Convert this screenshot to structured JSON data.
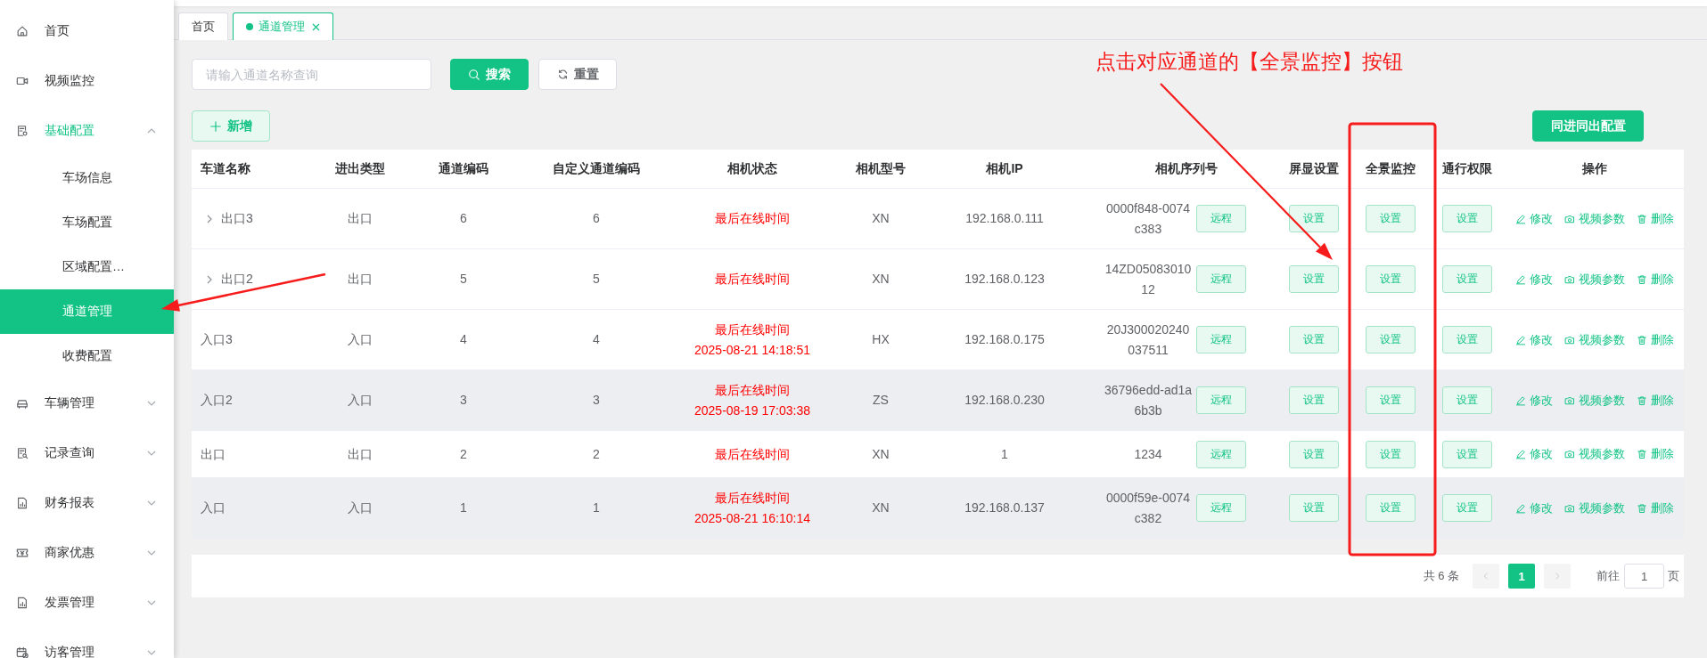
{
  "sidebar": {
    "items": [
      {
        "label": "首页",
        "selected": false
      },
      {
        "label": "视频监控",
        "selected": false
      },
      {
        "label": "基础配置",
        "selected": true,
        "expanded": true,
        "children": [
          {
            "label": "车场信息",
            "selected": false
          },
          {
            "label": "车场配置",
            "selected": false
          },
          {
            "label": "区域配置…",
            "selected": false
          },
          {
            "label": "通道管理",
            "selected": true
          },
          {
            "label": "收费配置",
            "selected": false
          }
        ]
      },
      {
        "label": "车辆管理",
        "selected": false,
        "expanded": false
      },
      {
        "label": "记录查询",
        "selected": false,
        "expanded": false
      },
      {
        "label": "财务报表",
        "selected": false,
        "expanded": false
      },
      {
        "label": "商家优惠",
        "selected": false,
        "expanded": false
      },
      {
        "label": "发票管理",
        "selected": false,
        "expanded": false
      },
      {
        "label": "访客管理",
        "selected": false,
        "expanded": false
      }
    ]
  },
  "tabs": [
    {
      "label": "首页",
      "selected": false,
      "closable": false
    },
    {
      "label": "通道管理",
      "selected": true,
      "closable": true
    }
  ],
  "toolbar": {
    "search": {
      "placeholder": "请输入通道名称查询"
    },
    "search_button": "搜索",
    "reset_button": "重置",
    "add_button": "新增",
    "sync_button": "同进同出配置"
  },
  "annotation": {
    "text": "点击对应通道的【全景监控】按钮"
  },
  "table": {
    "columns": [
      "车道名称",
      "进出类型",
      "通道编码",
      "自定义通道编码",
      "相机状态",
      "相机型号",
      "相机IP",
      "相机序列号",
      "屏显设置",
      "全景监控",
      "通行权限",
      "操作"
    ],
    "rows": [
      {
        "name": "出口3",
        "expanded": false,
        "shaded": false,
        "direction": "出口",
        "channel_code": "6",
        "custom_code": "6",
        "camera_status": "最后在线时间",
        "model": "XN",
        "ip": "192.168.0.111",
        "serial": "0000f848-0074c383",
        "remote_button": "远程",
        "screen_button": "设置",
        "panorama_button": "设置",
        "access_button": "设置",
        "actions": [
          {
            "kind": "edit",
            "label": "修改"
          },
          {
            "kind": "video",
            "label": "视频参数"
          },
          {
            "kind": "delete",
            "label": "删除"
          }
        ]
      },
      {
        "name": "出口2",
        "expanded": false,
        "shaded": false,
        "direction": "出口",
        "channel_code": "5",
        "custom_code": "5",
        "camera_status": "最后在线时间",
        "model": "XN",
        "ip": "192.168.0.123",
        "serial": "14ZD0508301012",
        "remote_button": "远程",
        "screen_button": "设置",
        "panorama_button": "设置",
        "access_button": "设置",
        "actions": [
          {
            "kind": "edit",
            "label": "修改"
          },
          {
            "kind": "video",
            "label": "视频参数"
          },
          {
            "kind": "delete",
            "label": "删除"
          }
        ]
      },
      {
        "name": "入口3",
        "shaded": false,
        "direction": "入口",
        "channel_code": "4",
        "custom_code": "4",
        "camera_status": "最后在线时间",
        "last_online": "2025-08-21 14:18:51",
        "model": "HX",
        "ip": "192.168.0.175",
        "serial": "20J300020240037511",
        "remote_button": "远程",
        "screen_button": "设置",
        "panorama_button": "设置",
        "access_button": "设置",
        "actions": [
          {
            "kind": "edit",
            "label": "修改"
          },
          {
            "kind": "video",
            "label": "视频参数"
          },
          {
            "kind": "delete",
            "label": "删除"
          }
        ]
      },
      {
        "name": "入口2",
        "shaded": true,
        "direction": "入口",
        "channel_code": "3",
        "custom_code": "3",
        "camera_status": "最后在线时间",
        "last_online": "2025-08-19 17:03:38",
        "model": "ZS",
        "ip": "192.168.0.230",
        "serial": "36796edd-ad1a6b3b",
        "remote_button": "远程",
        "screen_button": "设置",
        "panorama_button": "设置",
        "access_button": "设置",
        "actions": [
          {
            "kind": "edit",
            "label": "修改"
          },
          {
            "kind": "video",
            "label": "视频参数"
          },
          {
            "kind": "delete",
            "label": "删除"
          }
        ]
      },
      {
        "name": "出口",
        "shaded": false,
        "direction": "出口",
        "channel_code": "2",
        "custom_code": "2",
        "camera_status": "最后在线时间",
        "model": "XN",
        "ip": "1",
        "serial": "1234",
        "remote_button": "远程",
        "screen_button": "设置",
        "panorama_button": "设置",
        "access_button": "设置",
        "actions": [
          {
            "kind": "edit",
            "label": "修改"
          },
          {
            "kind": "video",
            "label": "视频参数"
          },
          {
            "kind": "delete",
            "label": "删除"
          }
        ]
      },
      {
        "name": "入口",
        "shaded": true,
        "direction": "入口",
        "channel_code": "1",
        "custom_code": "1",
        "camera_status": "最后在线时间",
        "last_online": "2025-08-21 16:10:14",
        "model": "XN",
        "ip": "192.168.0.137",
        "serial": "0000f59e-0074c382",
        "remote_button": "远程",
        "screen_button": "设置",
        "panorama_button": "设置",
        "access_button": "设置",
        "actions": [
          {
            "kind": "edit",
            "label": "修改"
          },
          {
            "kind": "video",
            "label": "视频参数"
          },
          {
            "kind": "delete",
            "label": "删除"
          }
        ]
      }
    ]
  },
  "pagination": {
    "total": "共 6 条",
    "prev": {
      "disabled": true
    },
    "pages": [
      {
        "label": "1",
        "selected": true
      }
    ],
    "next": {
      "disabled": true
    },
    "goto_label": "前往",
    "goto_value": "1",
    "suffix": "页"
  }
}
